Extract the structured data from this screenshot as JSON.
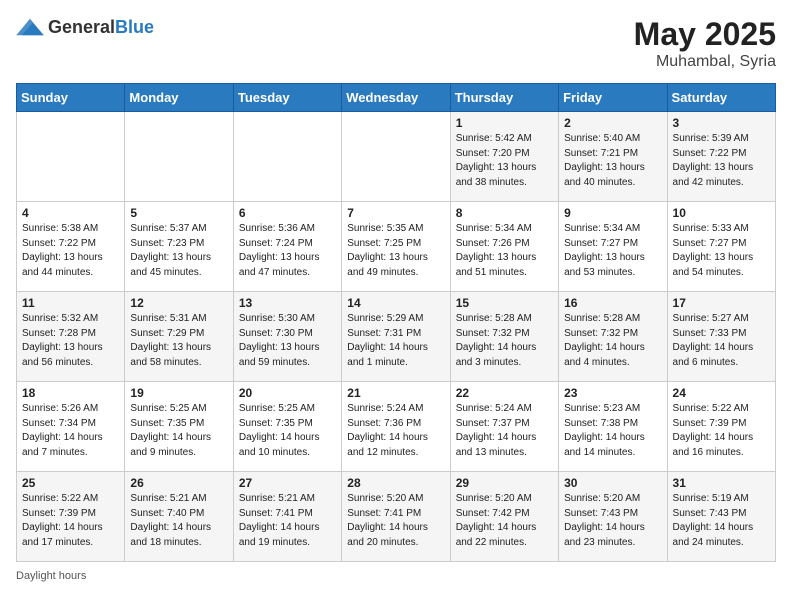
{
  "header": {
    "logo_general": "General",
    "logo_blue": "Blue",
    "month_year": "May 2025",
    "location": "Muhambal, Syria"
  },
  "days_of_week": [
    "Sunday",
    "Monday",
    "Tuesday",
    "Wednesday",
    "Thursday",
    "Friday",
    "Saturday"
  ],
  "footer": {
    "daylight_hours_label": "Daylight hours"
  },
  "weeks": [
    [
      {
        "day": "",
        "info": ""
      },
      {
        "day": "",
        "info": ""
      },
      {
        "day": "",
        "info": ""
      },
      {
        "day": "",
        "info": ""
      },
      {
        "day": "1",
        "info": "Sunrise: 5:42 AM\nSunset: 7:20 PM\nDaylight: 13 hours and 38 minutes."
      },
      {
        "day": "2",
        "info": "Sunrise: 5:40 AM\nSunset: 7:21 PM\nDaylight: 13 hours and 40 minutes."
      },
      {
        "day": "3",
        "info": "Sunrise: 5:39 AM\nSunset: 7:22 PM\nDaylight: 13 hours and 42 minutes."
      }
    ],
    [
      {
        "day": "4",
        "info": "Sunrise: 5:38 AM\nSunset: 7:22 PM\nDaylight: 13 hours and 44 minutes."
      },
      {
        "day": "5",
        "info": "Sunrise: 5:37 AM\nSunset: 7:23 PM\nDaylight: 13 hours and 45 minutes."
      },
      {
        "day": "6",
        "info": "Sunrise: 5:36 AM\nSunset: 7:24 PM\nDaylight: 13 hours and 47 minutes."
      },
      {
        "day": "7",
        "info": "Sunrise: 5:35 AM\nSunset: 7:25 PM\nDaylight: 13 hours and 49 minutes."
      },
      {
        "day": "8",
        "info": "Sunrise: 5:34 AM\nSunset: 7:26 PM\nDaylight: 13 hours and 51 minutes."
      },
      {
        "day": "9",
        "info": "Sunrise: 5:34 AM\nSunset: 7:27 PM\nDaylight: 13 hours and 53 minutes."
      },
      {
        "day": "10",
        "info": "Sunrise: 5:33 AM\nSunset: 7:27 PM\nDaylight: 13 hours and 54 minutes."
      }
    ],
    [
      {
        "day": "11",
        "info": "Sunrise: 5:32 AM\nSunset: 7:28 PM\nDaylight: 13 hours and 56 minutes."
      },
      {
        "day": "12",
        "info": "Sunrise: 5:31 AM\nSunset: 7:29 PM\nDaylight: 13 hours and 58 minutes."
      },
      {
        "day": "13",
        "info": "Sunrise: 5:30 AM\nSunset: 7:30 PM\nDaylight: 13 hours and 59 minutes."
      },
      {
        "day": "14",
        "info": "Sunrise: 5:29 AM\nSunset: 7:31 PM\nDaylight: 14 hours and 1 minute."
      },
      {
        "day": "15",
        "info": "Sunrise: 5:28 AM\nSunset: 7:32 PM\nDaylight: 14 hours and 3 minutes."
      },
      {
        "day": "16",
        "info": "Sunrise: 5:28 AM\nSunset: 7:32 PM\nDaylight: 14 hours and 4 minutes."
      },
      {
        "day": "17",
        "info": "Sunrise: 5:27 AM\nSunset: 7:33 PM\nDaylight: 14 hours and 6 minutes."
      }
    ],
    [
      {
        "day": "18",
        "info": "Sunrise: 5:26 AM\nSunset: 7:34 PM\nDaylight: 14 hours and 7 minutes."
      },
      {
        "day": "19",
        "info": "Sunrise: 5:25 AM\nSunset: 7:35 PM\nDaylight: 14 hours and 9 minutes."
      },
      {
        "day": "20",
        "info": "Sunrise: 5:25 AM\nSunset: 7:35 PM\nDaylight: 14 hours and 10 minutes."
      },
      {
        "day": "21",
        "info": "Sunrise: 5:24 AM\nSunset: 7:36 PM\nDaylight: 14 hours and 12 minutes."
      },
      {
        "day": "22",
        "info": "Sunrise: 5:24 AM\nSunset: 7:37 PM\nDaylight: 14 hours and 13 minutes."
      },
      {
        "day": "23",
        "info": "Sunrise: 5:23 AM\nSunset: 7:38 PM\nDaylight: 14 hours and 14 minutes."
      },
      {
        "day": "24",
        "info": "Sunrise: 5:22 AM\nSunset: 7:39 PM\nDaylight: 14 hours and 16 minutes."
      }
    ],
    [
      {
        "day": "25",
        "info": "Sunrise: 5:22 AM\nSunset: 7:39 PM\nDaylight: 14 hours and 17 minutes."
      },
      {
        "day": "26",
        "info": "Sunrise: 5:21 AM\nSunset: 7:40 PM\nDaylight: 14 hours and 18 minutes."
      },
      {
        "day": "27",
        "info": "Sunrise: 5:21 AM\nSunset: 7:41 PM\nDaylight: 14 hours and 19 minutes."
      },
      {
        "day": "28",
        "info": "Sunrise: 5:20 AM\nSunset: 7:41 PM\nDaylight: 14 hours and 20 minutes."
      },
      {
        "day": "29",
        "info": "Sunrise: 5:20 AM\nSunset: 7:42 PM\nDaylight: 14 hours and 22 minutes."
      },
      {
        "day": "30",
        "info": "Sunrise: 5:20 AM\nSunset: 7:43 PM\nDaylight: 14 hours and 23 minutes."
      },
      {
        "day": "31",
        "info": "Sunrise: 5:19 AM\nSunset: 7:43 PM\nDaylight: 14 hours and 24 minutes."
      }
    ]
  ]
}
